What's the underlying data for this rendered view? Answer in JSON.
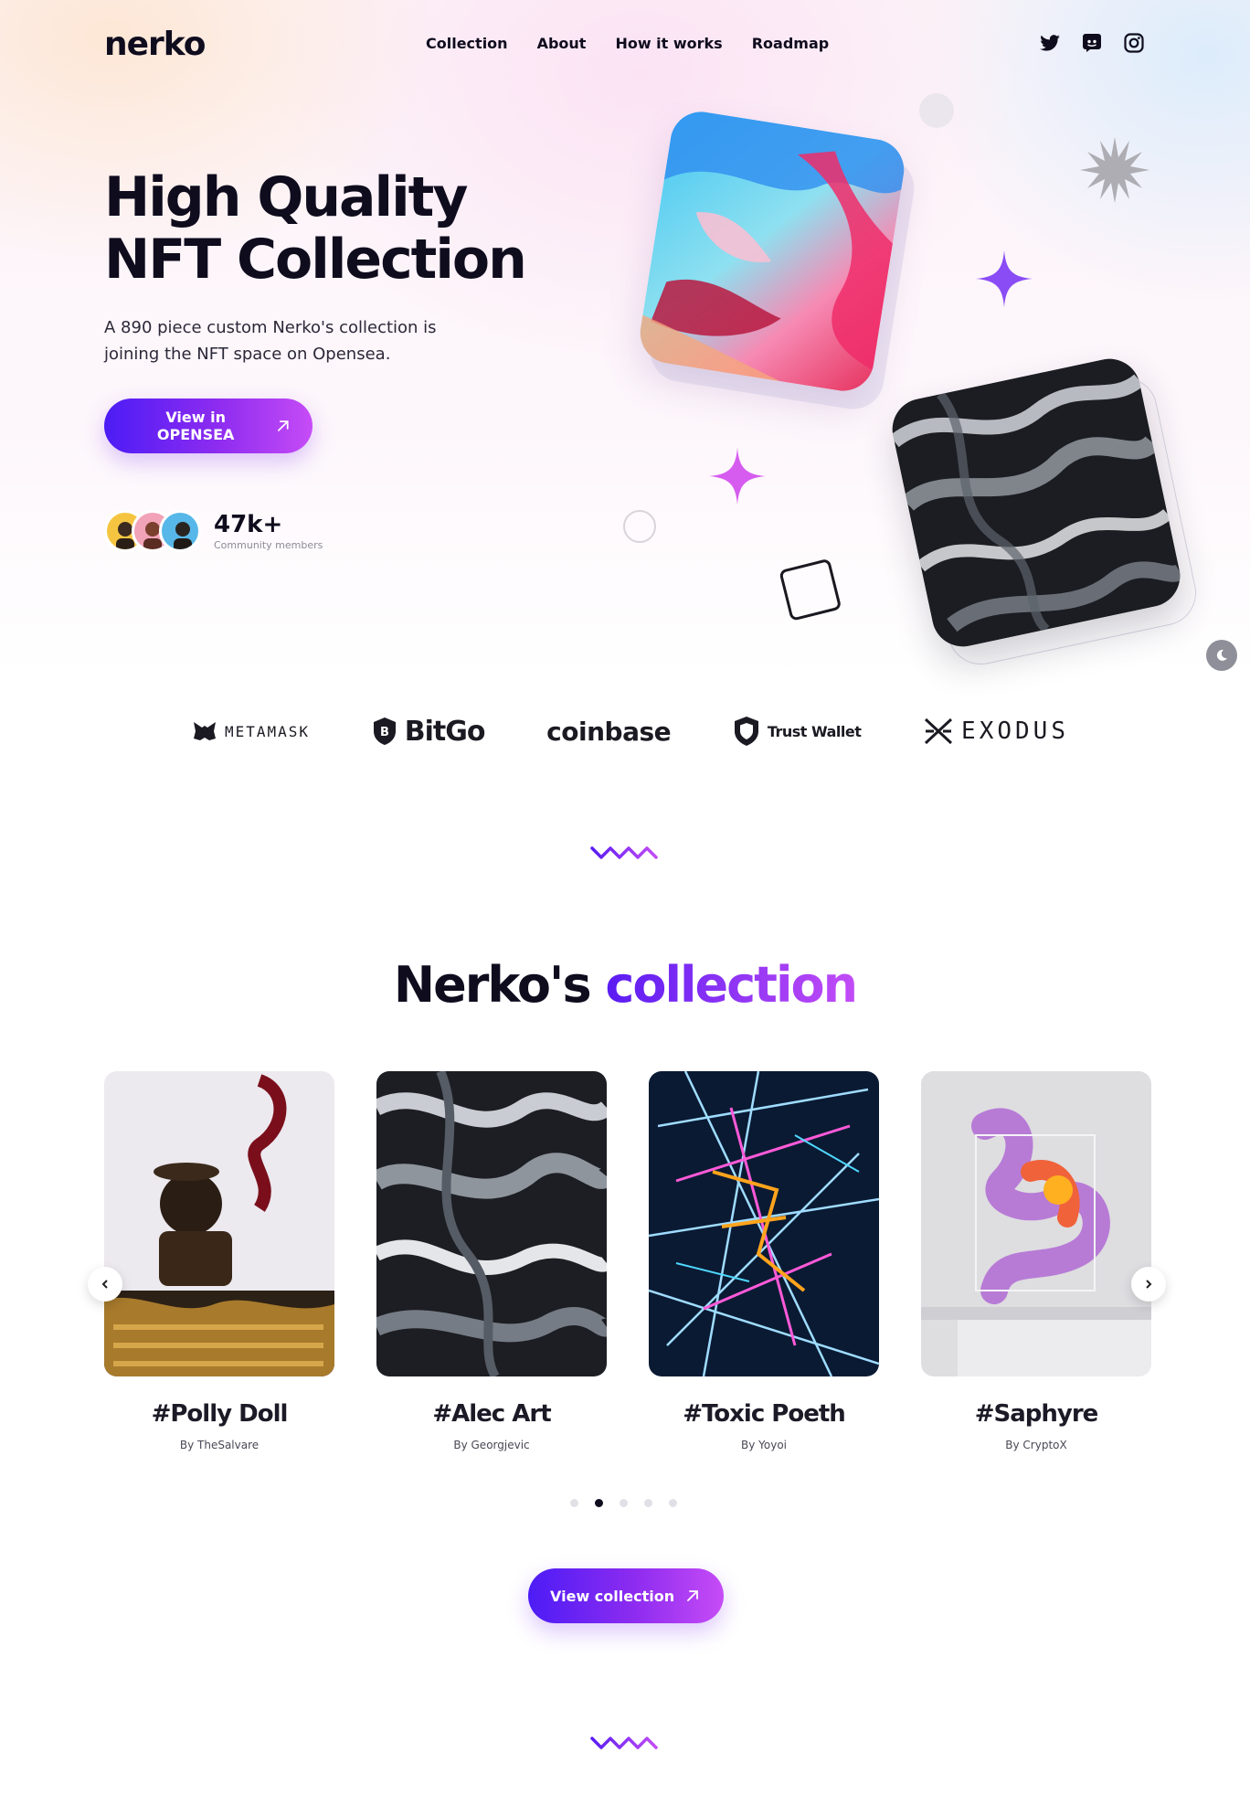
{
  "brand": {
    "logo": "nerko"
  },
  "nav": {
    "items": [
      "Collection",
      "About",
      "How it works",
      "Roadmap"
    ]
  },
  "socials": [
    "twitter-icon",
    "discord-icon",
    "instagram-icon"
  ],
  "hero": {
    "title_line1": "High Quality",
    "title_line2": "NFT Collection",
    "subtitle": "A 890 piece custom Nerko's collection is joining the NFT space on Opensea.",
    "cta_label": "View in OPENSEA",
    "community_count": "47k+",
    "community_label": "Community members"
  },
  "partners": [
    "METAMASK",
    "BitGo",
    "coinbase",
    "Trust Wallet",
    "EXODUS"
  ],
  "collection": {
    "title_main": "Nerko's",
    "title_accent": "collection",
    "items": [
      {
        "title": "#Polly Doll",
        "by": "By TheSalvare"
      },
      {
        "title": "#Alec Art",
        "by": "By Georgjevic"
      },
      {
        "title": "#Toxic Poeth",
        "by": "By Yoyoi"
      },
      {
        "title": "#Saphyre",
        "by": "By CryptoX"
      }
    ],
    "active_page": 2,
    "page_count": 5,
    "cta_label": "View collection"
  },
  "colors": {
    "accent_start": "#4c1cf5",
    "accent_end": "#c64cf6",
    "text": "#0f0c1e"
  }
}
